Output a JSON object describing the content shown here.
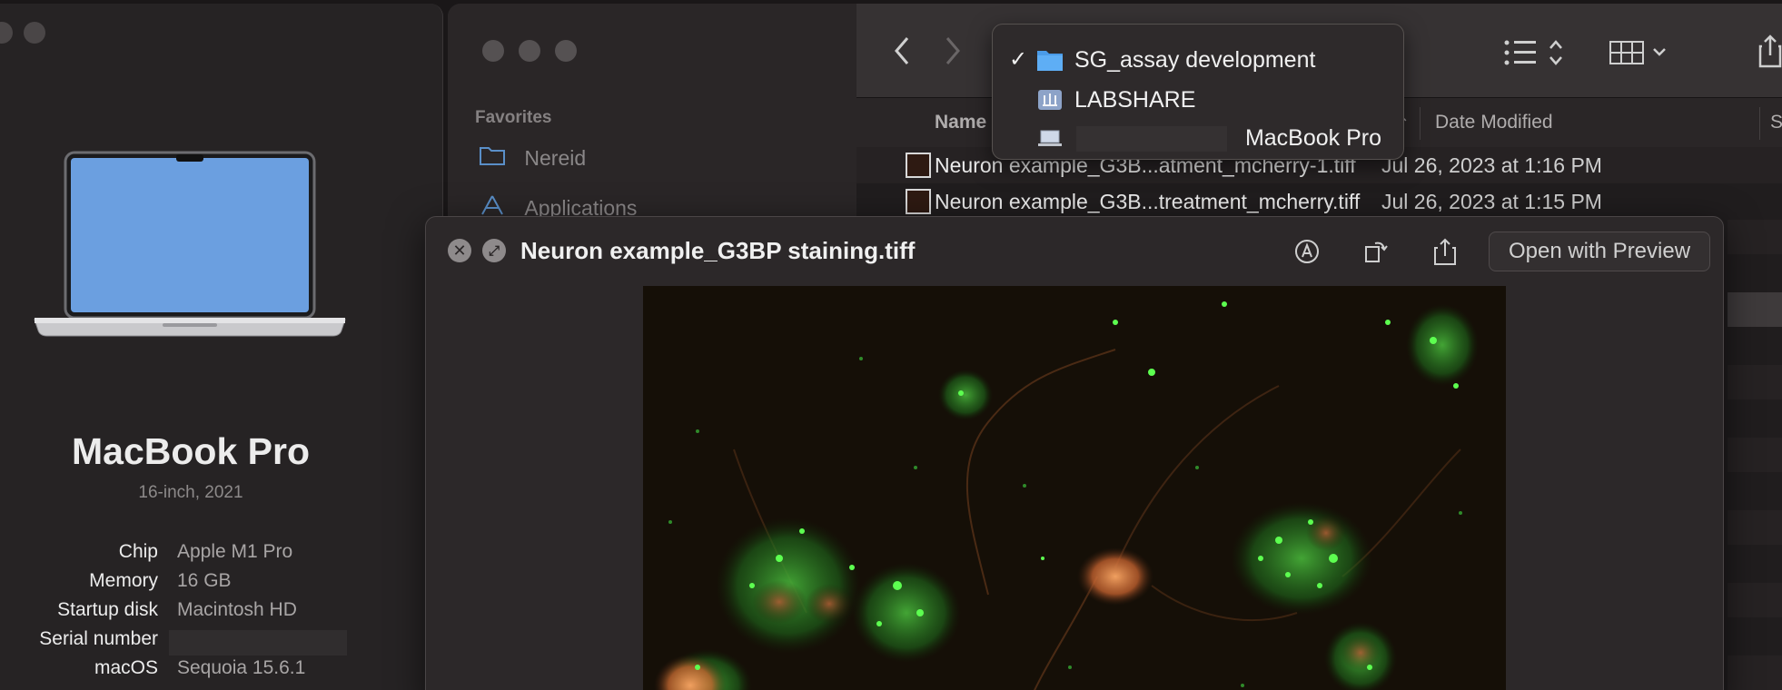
{
  "about": {
    "model_name": "MacBook Pro",
    "model_subtitle": "16-inch, 2021",
    "specs": [
      {
        "key": "Chip",
        "value": "Apple M1 Pro"
      },
      {
        "key": "Memory",
        "value": "16 GB"
      },
      {
        "key": "Startup disk",
        "value": "Macintosh HD"
      },
      {
        "key": "Serial number",
        "value": ""
      },
      {
        "key": "macOS",
        "value": "Sequoia 15.6.1"
      }
    ]
  },
  "finder": {
    "sidebar": {
      "heading": "Favorites",
      "items": [
        {
          "label": "Nereid",
          "icon": "folder-icon"
        },
        {
          "label": "Applications",
          "icon": "applications-icon"
        }
      ]
    },
    "columns": {
      "name": "Name",
      "date": "Date Modified"
    },
    "files": [
      {
        "name": "Neuron example_G3B...atment_mcherry-1.tiff",
        "date": "Jul 26, 2023 at 1:16 PM"
      },
      {
        "name": "Neuron example_G3B...treatment_mcherry.tiff",
        "date": "Jul 26, 2023 at 1:15 PM"
      }
    ]
  },
  "path_menu": {
    "items": [
      {
        "label": "SG_assay development",
        "icon": "folder-icon",
        "checked": true
      },
      {
        "label": "LABSHARE",
        "icon": "network-share-icon",
        "checked": false
      },
      {
        "label": "MacBook Pro",
        "icon": "laptop-icon",
        "checked": false
      }
    ],
    "check_glyph": "✓"
  },
  "quicklook": {
    "title": "Neuron example_G3BP staining.tiff",
    "open_button": "Open with Preview"
  },
  "colors": {
    "accent_folder": "#4a9be8",
    "fluorescence_green": "#3cd84a",
    "fluorescence_orange": "#e8824a"
  }
}
